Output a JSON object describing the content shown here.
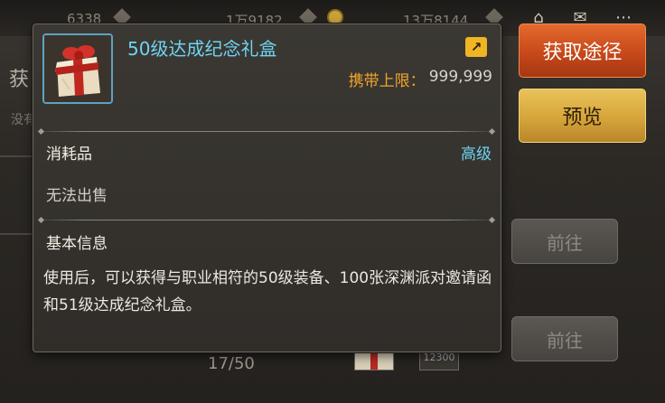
{
  "topbar": {
    "currency1": "6338",
    "currency2": "1万9182",
    "currency3": "13万8144"
  },
  "background": {
    "panel_title_char": "获",
    "panel_sub_text": "没有",
    "goto_buttons": [
      "前往",
      "前往"
    ],
    "progress": "17/50",
    "thumb_label": "12300"
  },
  "actions": {
    "acquire_label": "获取途径",
    "preview_label": "预览"
  },
  "tooltip": {
    "title": "50级达成纪念礼盒",
    "limit_label": "携带上限：",
    "limit_value": "999,999",
    "category": "消耗品",
    "grade": "高级",
    "sale_status": "无法出售",
    "section_title": "基本信息",
    "description": "使用后，可以获得与职业相符的50级装备、100张深渊派对邀请函和51级达成纪念礼盒。"
  },
  "colors": {
    "title": "#6ed3f2",
    "grade": "#6ed3f2",
    "limit_label": "#f1a52a",
    "acquire_button": "#c7481a",
    "preview_button": "#d6a53a"
  },
  "icons": {
    "item": "gift-box-icon",
    "share": "share-arrow-icon"
  }
}
